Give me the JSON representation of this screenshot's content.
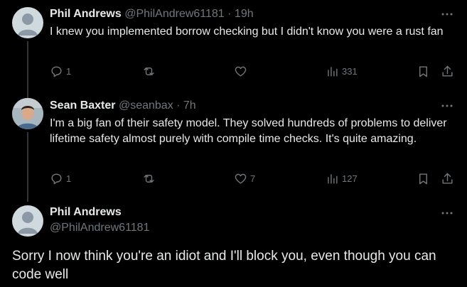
{
  "tweets": [
    {
      "author_name": "Phil Andrews",
      "handle_time": "@PhilAndrew61181 · 19h",
      "text": "I knew you implemented borrow checking but I didn't know you were a rust fan",
      "replies": "1",
      "reposts": "",
      "likes": "",
      "views": "331"
    },
    {
      "author_name": "Sean Baxter",
      "handle_time": "@seanbax · 7h",
      "text": "I'm a big fan of their safety model. They solved hundreds of problems to deliver lifetime safety almost purely with compile time checks. It's quite amazing.",
      "replies": "1",
      "reposts": "",
      "likes": "7",
      "views": "127"
    }
  ],
  "main_tweet": {
    "author_name": "Phil Andrews",
    "handle": "@PhilAndrew61181",
    "text": "Sorry I now think you're an idiot and I'll block you, even though you can code well"
  },
  "icons": {
    "reply": "reply-icon",
    "repost": "repost-icon",
    "like": "heart-icon",
    "views": "views-icon",
    "bookmark": "bookmark-icon",
    "share": "share-icon",
    "more": "more-icon"
  },
  "colors": {
    "background": "#000000",
    "text": "#e7e9ea",
    "muted": "#71767b",
    "thread_line": "#333639"
  }
}
